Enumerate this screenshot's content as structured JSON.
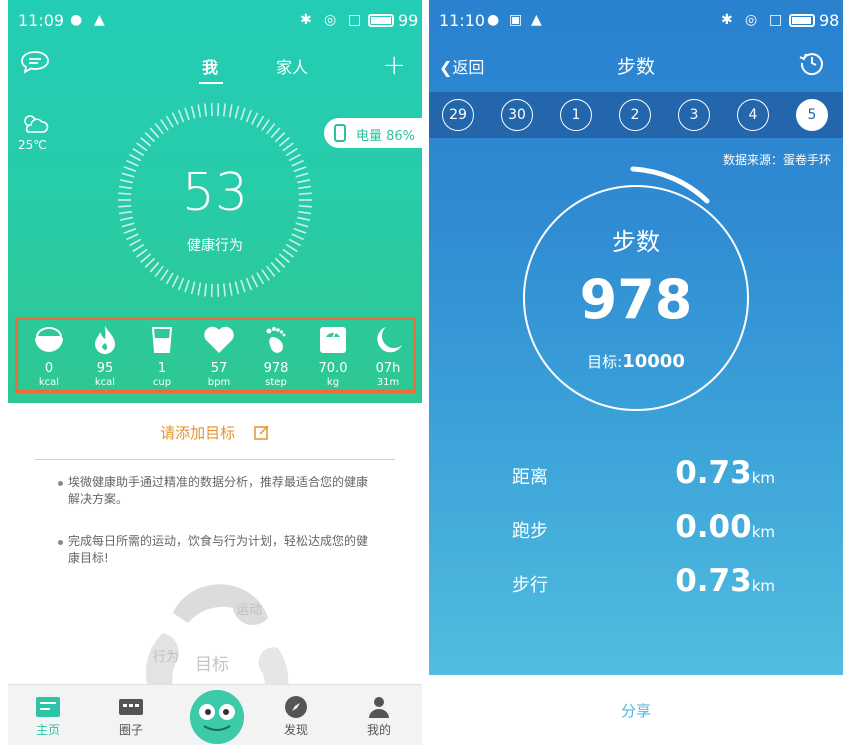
{
  "left": {
    "status": {
      "time": "11:09",
      "battery": "99"
    },
    "tabs": [
      "我",
      "家人"
    ],
    "weather": {
      "temp": "25℃"
    },
    "device_battery": "电量 86%",
    "score": {
      "value": "53",
      "label": "健康行为"
    },
    "metrics": [
      {
        "icon": "bowl-icon",
        "value": "0",
        "unit": "kcal"
      },
      {
        "icon": "flame-icon",
        "value": "95",
        "unit": "kcal"
      },
      {
        "icon": "cup-icon",
        "value": "1",
        "unit": "cup"
      },
      {
        "icon": "heart-icon",
        "value": "57",
        "unit": "bpm"
      },
      {
        "icon": "footprint-icon",
        "value": "978",
        "unit": "step"
      },
      {
        "icon": "scale-icon",
        "value": "70.0",
        "unit": "kg"
      },
      {
        "icon": "moon-icon",
        "value": "07h",
        "unit": "31m"
      }
    ],
    "add_goal": "请添加目标",
    "bullets": [
      "埃微健康助手通过精准的数据分析，推荐最适合您的健康 解决方案。",
      "完成每日所需的运动，饮食与行为计划，轻松达成您的健康目标!"
    ],
    "blob": {
      "a": "运动",
      "b": "行为",
      "c": "目标"
    },
    "nav": [
      "主页",
      "圈子",
      "发现",
      "我的"
    ],
    "colors": {
      "accent": "#2cc4a8",
      "highlight": "#f06a3a",
      "goal": "#e4942b"
    }
  },
  "right": {
    "status": {
      "time": "11:10",
      "battery": "98"
    },
    "back": "返回",
    "title": "步数",
    "dates": [
      "29",
      "30",
      "1",
      "2",
      "3",
      "4",
      "5"
    ],
    "selected_date": "5",
    "source": "数据来源：蛋卷手环",
    "ring": {
      "title": "步数",
      "value": "978",
      "target_label": "目标:",
      "target": "10000"
    },
    "stats": [
      {
        "label": "距离",
        "value": "0.73",
        "unit": "km"
      },
      {
        "label": "跑步",
        "value": "0.00",
        "unit": "km"
      },
      {
        "label": "步行",
        "value": "0.73",
        "unit": "km"
      }
    ],
    "share": "分享",
    "colors": {
      "header": "#2366ab",
      "gradient_top": "#2a82cf",
      "gradient_bottom": "#50bedf"
    }
  }
}
